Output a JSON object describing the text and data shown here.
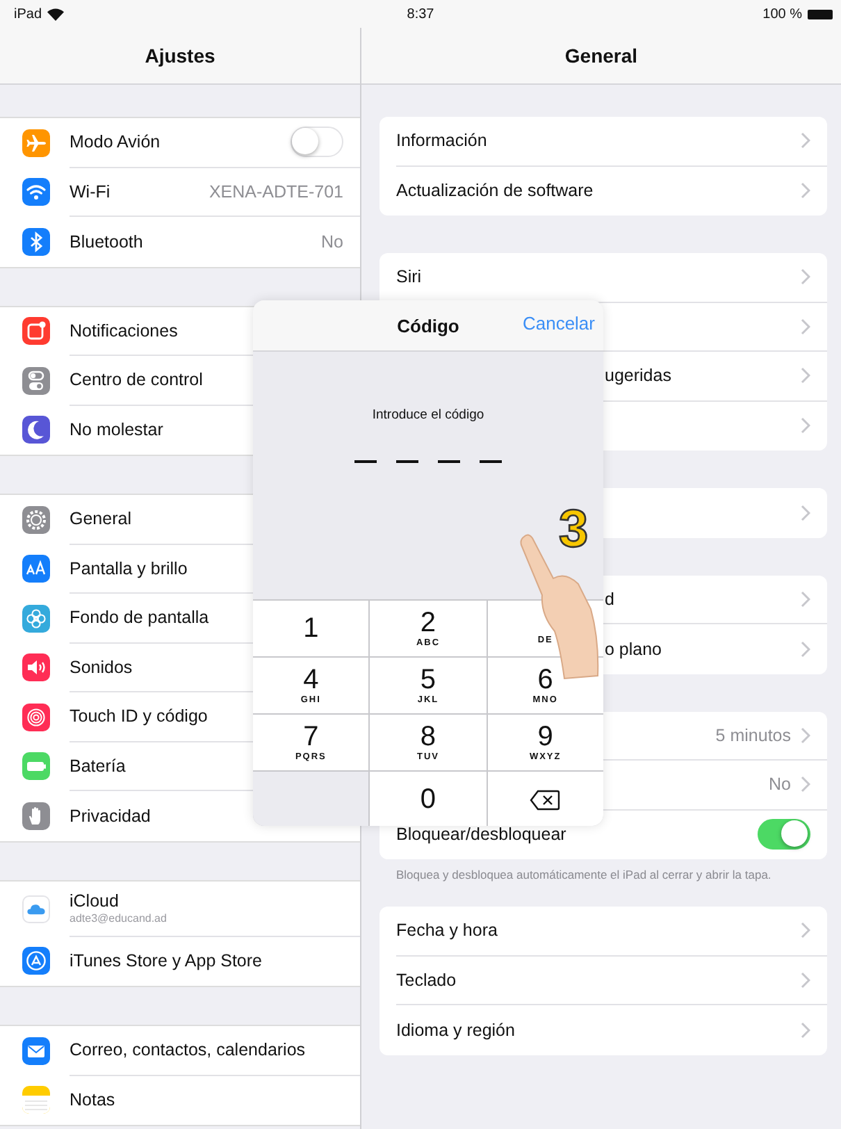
{
  "status_bar": {
    "device": "iPad",
    "time": "8:37",
    "battery": "100 %"
  },
  "sidebar": {
    "title": "Ajustes",
    "groups": [
      [
        {
          "label": "Modo Avión",
          "color": "#ff9500",
          "kind": "toggle",
          "on": false
        },
        {
          "label": "Wi-Fi",
          "color": "#147efb",
          "kind": "value",
          "value": "XENA-ADTE-701"
        },
        {
          "label": "Bluetooth",
          "color": "#147efb",
          "kind": "value",
          "value": "No"
        }
      ],
      [
        {
          "label": "Notificaciones",
          "color": "#ff3b30",
          "kind": "plain"
        },
        {
          "label": "Centro de control",
          "color": "#8e8e93",
          "kind": "plain"
        },
        {
          "label": "No molestar",
          "color": "#5856d6",
          "kind": "plain"
        }
      ],
      [
        {
          "label": "General",
          "color": "#8e8e93",
          "kind": "plain"
        },
        {
          "label": "Pantalla y brillo",
          "color": "#147efb",
          "kind": "plain"
        },
        {
          "label": "Fondo de pantalla",
          "color": "#34aadc",
          "kind": "plain"
        },
        {
          "label": "Sonidos",
          "color": "#ff2d55",
          "kind": "plain"
        },
        {
          "label": "Touch ID y código",
          "color": "#ff2d55",
          "kind": "plain"
        },
        {
          "label": "Batería",
          "color": "#4cd964",
          "kind": "plain"
        },
        {
          "label": "Privacidad",
          "color": "#8e8e93",
          "kind": "plain"
        }
      ],
      [
        {
          "label": "iCloud",
          "color": "#ffffff",
          "kind": "account",
          "subtitle": "adte3@educand.ad"
        },
        {
          "label": "iTunes Store y App Store",
          "color": "#147efb",
          "kind": "plain"
        }
      ],
      [
        {
          "label": "Correo, contactos, calendarios",
          "color": "#147efb",
          "kind": "plain"
        },
        {
          "label": "Notas",
          "color": "#ffcc00",
          "kind": "plain"
        }
      ]
    ]
  },
  "detail": {
    "title": "General",
    "groups": [
      {
        "rows": [
          {
            "label": "Información",
            "kind": "link"
          },
          {
            "label": "Actualización de software",
            "kind": "link"
          }
        ]
      },
      {
        "rows": [
          {
            "label": "Siri",
            "kind": "link"
          },
          {
            "kind": "covered"
          },
          {
            "label": "ugeridas",
            "kind": "covered"
          },
          {
            "kind": "covered"
          }
        ]
      },
      {
        "rows": [
          {
            "kind": "covered"
          }
        ]
      },
      {
        "rows": [
          {
            "label": "d",
            "kind": "covered"
          },
          {
            "label": "o plano",
            "kind": "covered"
          }
        ]
      },
      {
        "rows": [
          {
            "kind": "covered",
            "value": "5 minutos"
          },
          {
            "kind": "covered",
            "value": "No"
          },
          {
            "label": "Bloquear/desbloquear",
            "kind": "toggle",
            "on": true
          }
        ],
        "footer": "Bloquea y desbloquea automáticamente el iPad al cerrar y abrir la tapa."
      },
      {
        "rows": [
          {
            "label": "Fecha y hora",
            "kind": "link"
          },
          {
            "label": "Teclado",
            "kind": "link"
          },
          {
            "label": "Idioma y región",
            "kind": "link"
          }
        ]
      }
    ]
  },
  "passcode_dialog": {
    "title": "Código",
    "cancel": "Cancelar",
    "prompt": "Introduce el código",
    "code_slots": [
      {
        "filled": false
      },
      {
        "filled": false
      },
      {
        "filled": false
      },
      {
        "filled": false
      }
    ],
    "keys": [
      {
        "kind": "digit",
        "digit": "1"
      },
      {
        "kind": "digit",
        "digit": "2",
        "letters": "ABC"
      },
      {
        "kind": "digit",
        "letters": "DE"
      },
      {
        "kind": "digit",
        "digit": "4",
        "letters": "GHI"
      },
      {
        "kind": "digit",
        "digit": "5",
        "letters": "JKL"
      },
      {
        "kind": "digit",
        "digit": "6",
        "letters": "MNO"
      },
      {
        "kind": "digit",
        "digit": "7",
        "letters": "PQRS"
      },
      {
        "kind": "digit",
        "digit": "8",
        "letters": "TUV"
      },
      {
        "kind": "digit",
        "digit": "9",
        "letters": "WXYZ"
      },
      {
        "kind": "blank"
      },
      {
        "kind": "digit",
        "digit": "0"
      },
      {
        "kind": "delete"
      }
    ]
  },
  "tutorial_overlay": {
    "step_marker": "3"
  }
}
